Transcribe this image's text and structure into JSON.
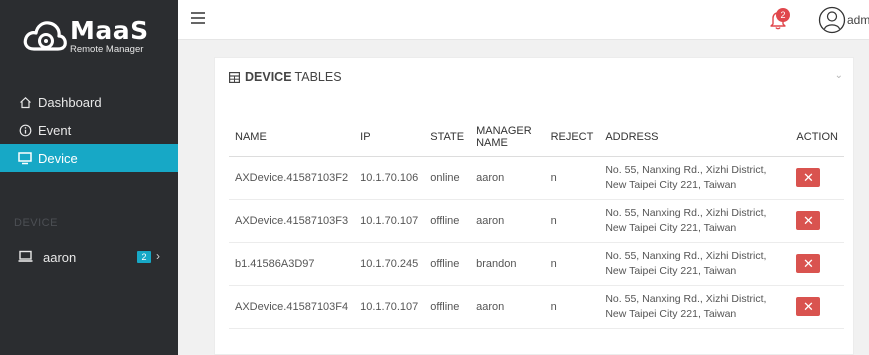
{
  "brand": {
    "title": "MaaS",
    "subtitle": "Remote Manager"
  },
  "sidebar": {
    "items": [
      {
        "label": "Dashboard",
        "icon": "home-icon"
      },
      {
        "label": "Event",
        "icon": "info-icon"
      },
      {
        "label": "Device",
        "icon": "monitor-icon",
        "active": true
      }
    ],
    "section_label": "DEVICE",
    "device_group": {
      "label": "aaron",
      "count": "2",
      "icon": "laptop-icon"
    }
  },
  "header": {
    "notification_count": "2",
    "user": "admi"
  },
  "card": {
    "title_bold": "DEVICE",
    "title_rest": "TABLES"
  },
  "table": {
    "columns": [
      "NAME",
      "IP",
      "STATE",
      "MANAGER NAME",
      "REJECT",
      "ADDRESS",
      "ACTION"
    ],
    "rows": [
      {
        "name": "AXDevice.41587103F2",
        "ip": "10.1.70.106",
        "state": "online",
        "manager": "aaron",
        "reject": "n",
        "address": "No. 55, Nanxing Rd., Xizhi District, New Taipei City 221, Taiwan"
      },
      {
        "name": "AXDevice.41587103F3",
        "ip": "10.1.70.107",
        "state": "offline",
        "manager": "aaron",
        "reject": "n",
        "address": "No. 55, Nanxing Rd., Xizhi District, New Taipei City 221, Taiwan"
      },
      {
        "name": "b1.41586A3D97",
        "ip": "10.1.70.245",
        "state": "offline",
        "manager": "brandon",
        "reject": "n",
        "address": "No. 55, Nanxing Rd., Xizhi District, New Taipei City 221, Taiwan"
      },
      {
        "name": "AXDevice.41587103F4",
        "ip": "10.1.70.107",
        "state": "offline",
        "manager": "aaron",
        "reject": "n",
        "address": "No. 55, Nanxing Rd., Xizhi District, New Taipei City 221, Taiwan"
      }
    ],
    "action_symbol": "✕"
  },
  "colors": {
    "sidebar_bg": "#2b2d30",
    "accent": "#17a8c6",
    "danger": "#d9534f",
    "badge": "#e0474c"
  }
}
